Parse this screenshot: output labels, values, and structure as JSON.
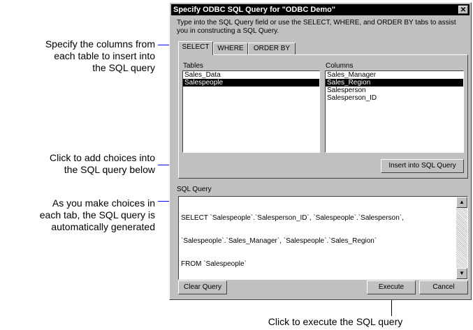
{
  "callouts": {
    "columns": [
      "Specify the columns from",
      "each table to insert into",
      "the SQL query"
    ],
    "insert": [
      "Click to add choices into",
      "the SQL query below"
    ],
    "generated": [
      "As you make choices in",
      "each tab, the SQL query is",
      "automatically generated"
    ],
    "execute": "Click to execute the SQL query"
  },
  "dialog": {
    "title": "Specify ODBC SQL Query for \"ODBC Demo\"",
    "close_glyph": "✕",
    "intro": "Type into the SQL Query field or use the SELECT, WHERE, and ORDER BY tabs to assist you in constructing a SQL Query.",
    "tabs": [
      "SELECT",
      "WHERE",
      "ORDER BY"
    ],
    "tables_label": "Tables",
    "columns_label": "Columns",
    "tables": [
      "Sales_Data",
      "Salespeople"
    ],
    "columns": [
      "Sales_Manager",
      "Sales_Region",
      "Salesperson",
      "Salesperson_ID"
    ],
    "insert_button": "Insert into SQL Query",
    "query_label": "SQL Query",
    "query_lines": [
      "SELECT `Salespeople`.`Salesperson_ID`, `Salespeople`.`Salesperson`,",
      "`Salespeople`.`Sales_Manager`, `Salespeople`.`Sales_Region`",
      "FROM `Salespeople`"
    ],
    "clear_button": "Clear Query",
    "execute_button": "Execute",
    "cancel_button": "Cancel"
  }
}
